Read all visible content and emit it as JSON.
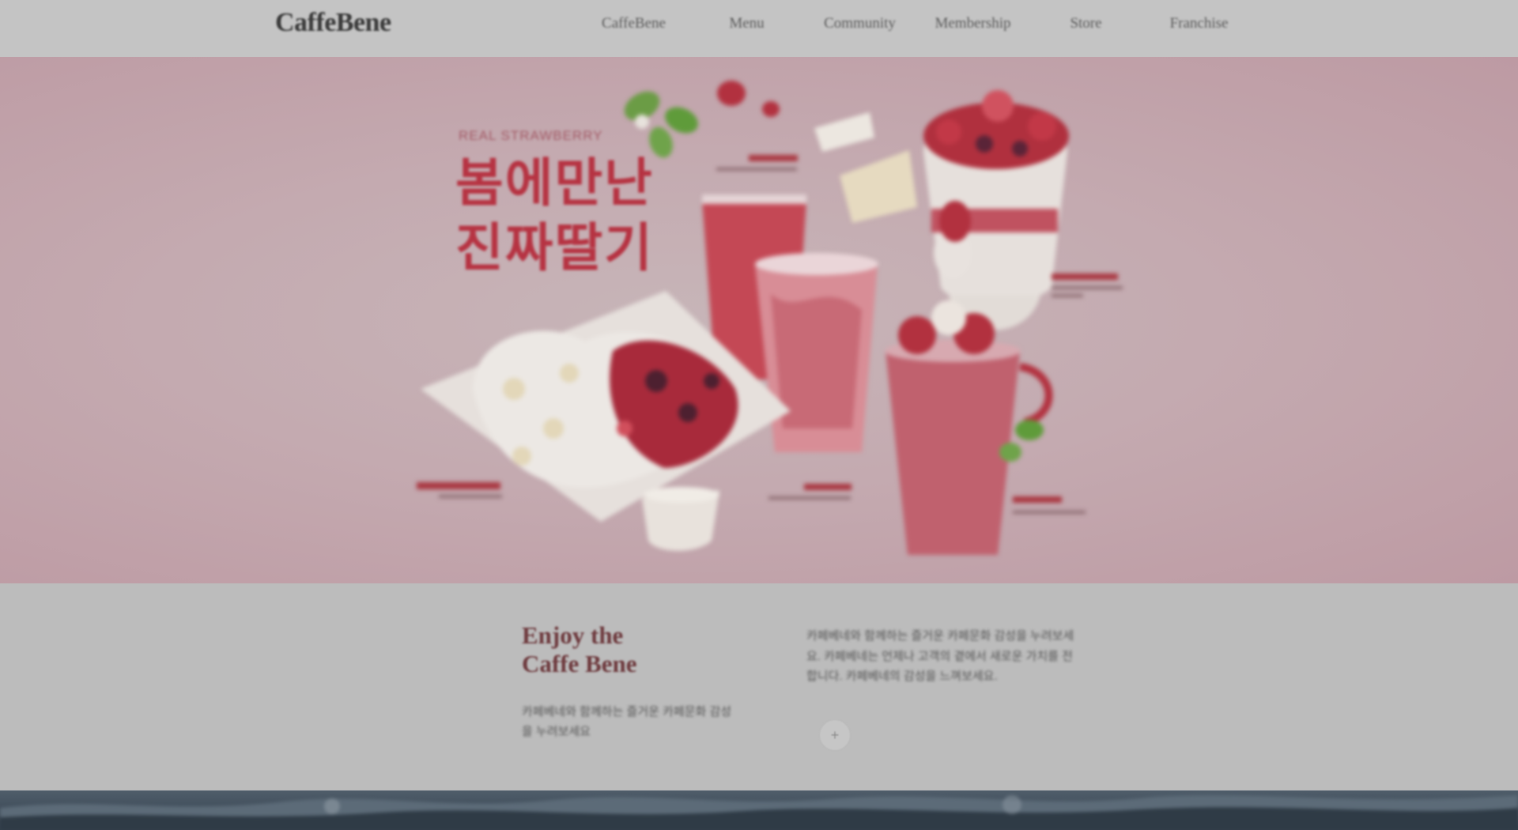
{
  "header": {
    "logo": "CaffeBene",
    "nav": [
      "CaffeBene",
      "Menu",
      "Community",
      "Membership",
      "Store",
      "Franchise"
    ]
  },
  "hero": {
    "kicker": "REAL STRAWBERRY",
    "title": "봄에만난\n진짜딸기",
    "palette": {
      "background": "#c4aab0",
      "title": "#b63342",
      "strawberry": "#b2313f",
      "drink": "#c8636f",
      "cream": "#e7e2dc",
      "leaf": "#5f9b3a"
    }
  },
  "intro": {
    "heading": "Enjoy the\nCaffe Bene",
    "description": "카페베네와 함께하는 즐거운 카페문화 감성을 누려보세요",
    "body": "카페베네와 함께하는 즐거운 카페문화 감성을 누려보세요. 카페베네는 언제나 고객의 곁에서 새로운 가치를 전합니다. 카페베네의 감성을 느껴보세요.",
    "more_icon": "plus-icon",
    "more_symbol": "+"
  },
  "colors": {
    "header_bg": "#c4c4c4",
    "accent": "#6e3a3e",
    "scenic": "#3e4b58"
  }
}
